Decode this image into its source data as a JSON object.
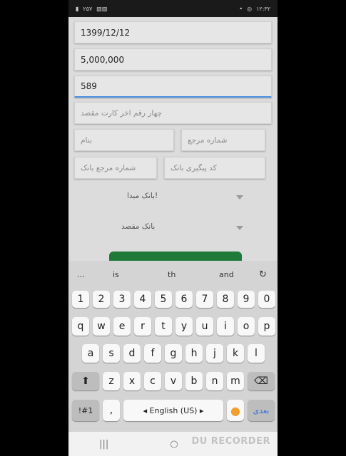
{
  "status_bar": {
    "left_text": "۲۵۷",
    "right_time": "۱۲:۳۲"
  },
  "form": {
    "date_value": "1399/12/12",
    "amount_value": "5,000,000",
    "card_digits_value": "589",
    "dest_card_placeholder": "چهار رقم اخر کارت مقصد",
    "reference_placeholder": "شماره مرجع",
    "name_placeholder": "بنام",
    "tracking_placeholder": "کد پیگیری بانک",
    "bank_ref_placeholder": "شماره مرجع بانک",
    "origin_bank_label": "بانک مبدا!",
    "dest_bank_label": "بانک مقصد"
  },
  "keyboard": {
    "suggestions": [
      "…",
      "is",
      "th",
      "and"
    ],
    "number_row": [
      "1",
      "2",
      "3",
      "4",
      "5",
      "6",
      "7",
      "8",
      "9",
      "0"
    ],
    "row1": [
      "q",
      "w",
      "e",
      "r",
      "t",
      "y",
      "u",
      "i",
      "o",
      "p"
    ],
    "row2": [
      "a",
      "s",
      "d",
      "f",
      "g",
      "h",
      "j",
      "k",
      "l"
    ],
    "row3": [
      "z",
      "x",
      "c",
      "v",
      "b",
      "n",
      "m"
    ],
    "symbols_label": "!#1",
    "comma_label": ",",
    "space_label": "◂ English (US) ▸",
    "next_label": "بعدی"
  },
  "nav": {
    "recents": "|||",
    "home": "○",
    "watermark": "DU RECORDER"
  }
}
